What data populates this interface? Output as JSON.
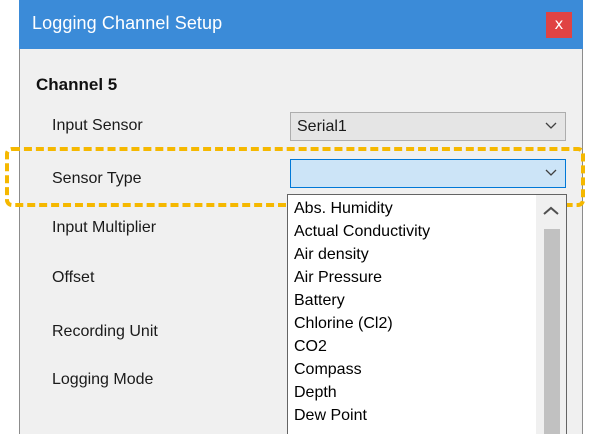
{
  "window": {
    "title": "Logging Channel Setup",
    "close_glyph": "x"
  },
  "heading": "Channel 5",
  "fields": {
    "input_sensor": {
      "label": "Input Sensor",
      "value": "Serial1"
    },
    "sensor_type": {
      "label": "Sensor Type",
      "value": ""
    },
    "input_multiplier": {
      "label": "Input Multiplier"
    },
    "offset": {
      "label": "Offset"
    },
    "recording_unit": {
      "label": "Recording Unit"
    },
    "logging_mode": {
      "label": "Logging Mode"
    }
  },
  "dropdown": {
    "options": [
      "Abs. Humidity",
      "Actual Conductivity",
      "Air density",
      "Air Pressure",
      "Battery",
      "Chlorine (Cl2)",
      "CO2",
      "Compass",
      "Depth",
      "Dew Point"
    ]
  },
  "icons": {
    "close": "close-icon",
    "combo_arrow": "chevron-down-icon",
    "scroll_up": "chevron-up-icon"
  },
  "colors": {
    "titlebar": "#3b8bd8",
    "close_button": "#e04343",
    "highlight_dashes": "#f5b800",
    "active_combo": "#cce4f7"
  }
}
